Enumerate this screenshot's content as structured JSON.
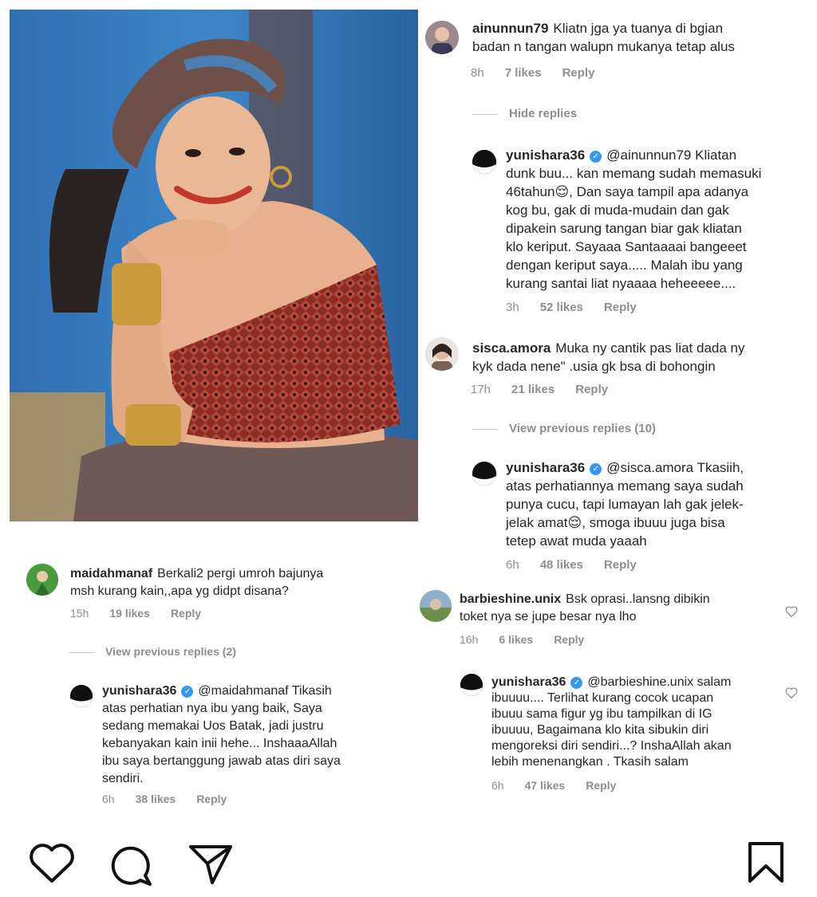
{
  "comments_right": [
    {
      "username": "ainunnun79",
      "text_lines": [
        "Kliatn jga ya tuanya di bgian",
        "badan n tangan walupn mukanya tetap alus"
      ],
      "time": "8h",
      "likes": "7 likes",
      "reply": "Reply",
      "toggle": "Hide replies"
    },
    {
      "username": "yunishara36",
      "verified": true,
      "mention": "@ainunnun79",
      "text_lines": [
        "Kliatan",
        "dunk buu... kan memang sudah memasuki",
        "46tahun😌, Dan saya tampil apa adanya",
        "kog bu, gak di muda-mudain dan gak",
        "dipakein sarung tangan biar gak kliatan",
        "klo keriput.  Sayaaa Santaaaai bangeeet",
        "dengan keriput saya..... Malah ibu yang",
        "kurang santai liat nyaaaa heheeeee...."
      ],
      "time": "3h",
      "likes": "52 likes",
      "reply": "Reply"
    },
    {
      "username": "sisca.amora",
      "text_lines": [
        "Muka ny cantik pas liat dada ny",
        "kyk dada nene\" .usia gk bsa di bohongin"
      ],
      "time": "17h",
      "likes": "21 likes",
      "reply": "Reply",
      "toggle": "View previous replies (10)"
    },
    {
      "username": "yunishara36",
      "verified": true,
      "mention": "@sisca.amora",
      "text_lines": [
        "Tkasiih,",
        "atas perhatiannya memang saya sudah",
        "punya cucu, tapi lumayan lah gak jelek-",
        "jelak amat😌, smoga ibuuu juga bisa",
        "tetep awat muda yaaah"
      ],
      "time": "6h",
      "likes": "48 likes",
      "reply": "Reply"
    },
    {
      "username": "barbieshine.unix",
      "text_lines": [
        "Bsk oprasi..lansng dibikin",
        "toket nya se jupe besar nya lho"
      ],
      "time": "16h",
      "likes": "6 likes",
      "reply": "Reply"
    },
    {
      "username": "yunishara36",
      "verified": true,
      "mention": "@barbieshine.unix",
      "text_lines": [
        "salam",
        "ibuuuu.... Terlihat kurang cocok ucapan",
        "ibuuu sama figur yg ibu tampilkan di IG",
        "ibuuuu, Bagaimana klo kita sibukin diri",
        "mengoreksi diri sendiri...? InshaAllah akan",
        "lebih menenangkan . Tkasih salam"
      ],
      "time": "6h",
      "likes": "47 likes",
      "reply": "Reply"
    }
  ],
  "comments_left": [
    {
      "username": "maidahmanaf",
      "text_lines": [
        "Berkali2 pergi umroh bajunya",
        "msh kurang kain,,apa yg didpt disana?"
      ],
      "time": "15h",
      "likes": "19 likes",
      "reply": "Reply",
      "toggle": "View previous replies (2)"
    },
    {
      "username": "yunishara36",
      "verified": true,
      "mention": "@maidahmanaf",
      "text_lines": [
        "Tikasih",
        "atas perhatian nya ibu yang baik,  Saya",
        "sedang memakai Uos Batak, jadi justru",
        "kebanyakan kain inii hehe... InshaaaAllah",
        "ibu saya bertanggung jawab atas diri saya",
        "sendiri."
      ],
      "time": "6h",
      "likes": "38 likes",
      "reply": "Reply"
    }
  ],
  "icons": {
    "like": "heart-icon",
    "comment": "comment-bubble-icon",
    "share": "paper-plane-icon",
    "save": "bookmark-icon"
  },
  "colors": {
    "text": "#262626",
    "meta": "#8e8e8e",
    "verified": "#3897f0"
  }
}
